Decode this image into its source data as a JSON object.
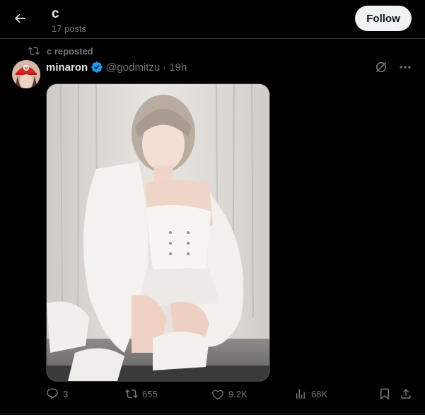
{
  "header": {
    "title": "c",
    "post_count": "17 posts",
    "follow_label": "Follow"
  },
  "repost": {
    "text": "c reposted"
  },
  "post": {
    "author_name": "minaron",
    "handle": "@godmitzu",
    "separator": "·",
    "time": "19h",
    "verified": true,
    "media_alt": "photo",
    "stats": {
      "replies": "3",
      "reposts": "655",
      "likes": "9.2K",
      "views": "68K"
    }
  },
  "colors": {
    "background": "#000000",
    "text_primary": "#e7e9ea",
    "text_secondary": "#71767b",
    "verified_blue": "#1d9bf0",
    "follow_bg": "#eff3f4"
  },
  "icons": {
    "back": "arrow-left-icon",
    "repost": "repost-icon",
    "verified": "verified-badge-icon",
    "grok": "grok-icon",
    "more": "more-icon",
    "reply": "reply-icon",
    "like": "heart-icon",
    "views": "views-icon",
    "bookmark": "bookmark-icon",
    "share": "share-icon"
  }
}
